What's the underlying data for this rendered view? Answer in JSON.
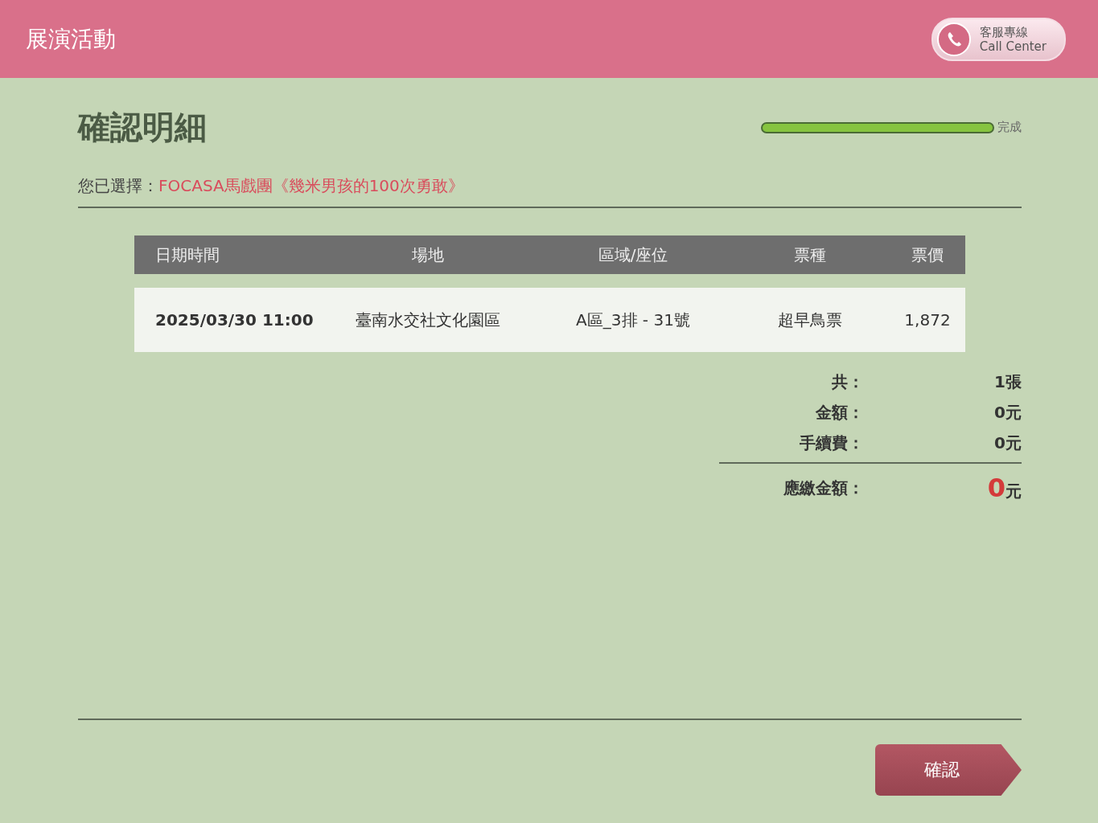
{
  "header": {
    "title": "展演活動",
    "call_center": {
      "label_zh": "客服專線",
      "label_en": "Call Center"
    }
  },
  "page_title": "確認明細",
  "progress": {
    "level": 1,
    "label": "完成"
  },
  "selection": {
    "label": "您已選擇：",
    "value": "FOCASA馬戲團《幾米男孩的100次勇敢》"
  },
  "table": {
    "columns": [
      "日期時間",
      "場地",
      "區域/座位",
      "票種",
      "票價"
    ],
    "rows": [
      [
        "2025/03/30 11:00",
        "臺南水交社文化園區",
        "A區_3排 - 31號",
        "超早鳥票",
        "1,872"
      ]
    ]
  },
  "summary": [
    {
      "label": "共：",
      "value": "1張"
    },
    {
      "label": "金額：",
      "value": "0元"
    },
    {
      "label": "手續費：",
      "value": "0元"
    }
  ],
  "total": {
    "label": "應繳金額：",
    "amount": "0",
    "unit": "元"
  },
  "confirm_button": "確認"
}
